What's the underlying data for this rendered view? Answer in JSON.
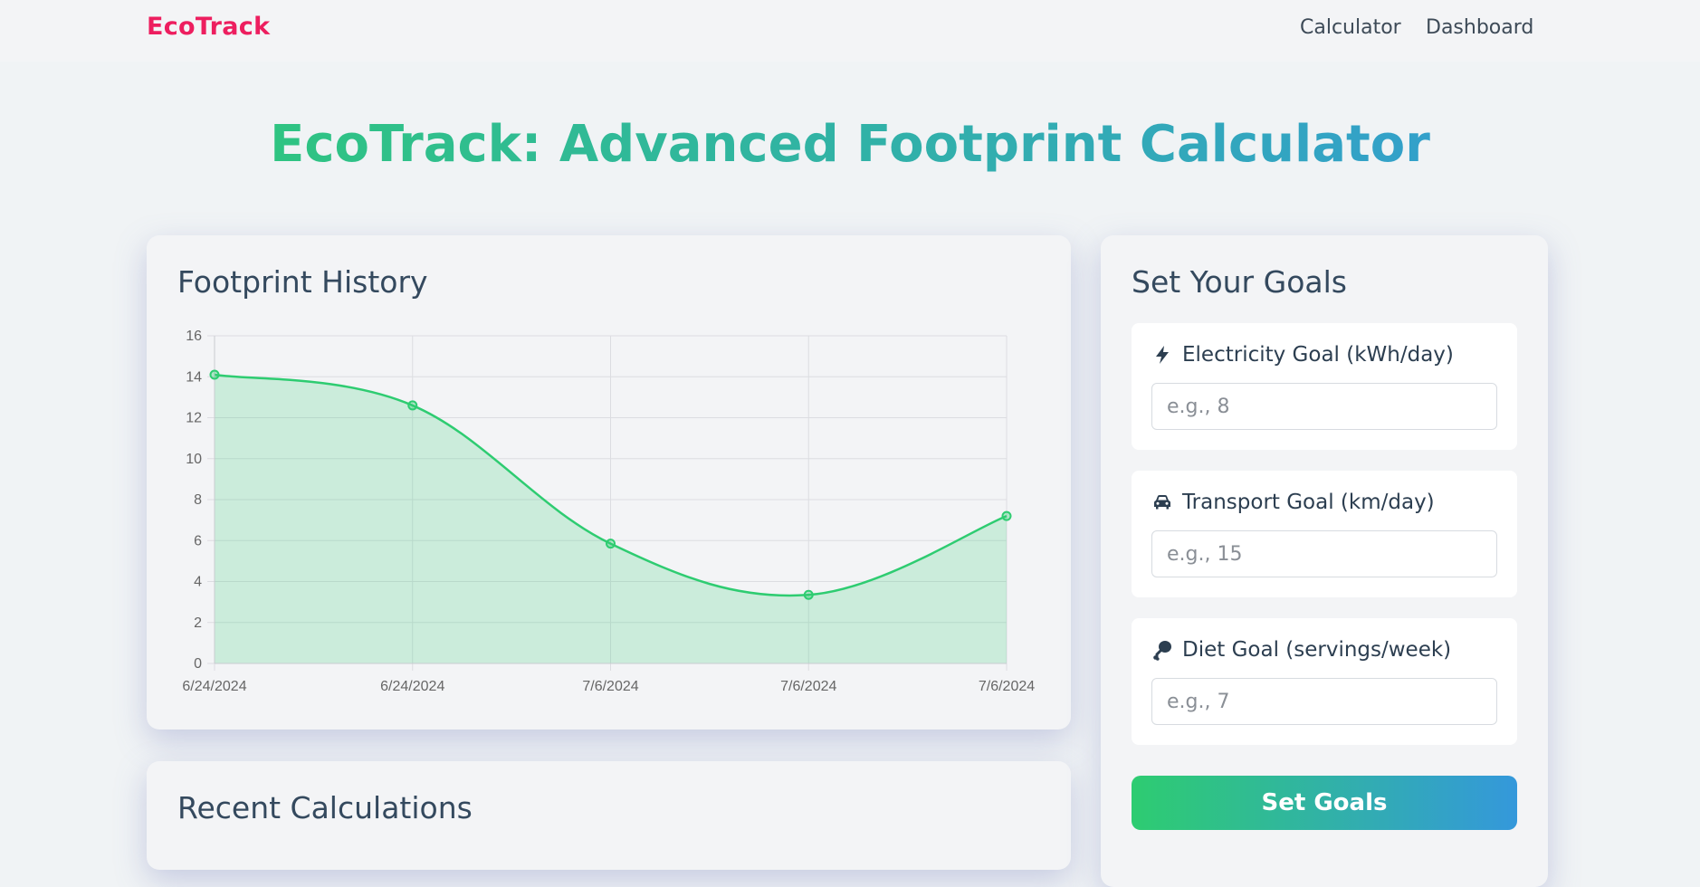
{
  "navbar": {
    "brand": "EcoTrack",
    "links": [
      "Calculator",
      "Dashboard"
    ]
  },
  "hero": {
    "title": "EcoTrack: Advanced Footprint Calculator"
  },
  "history": {
    "title": "Footprint History"
  },
  "recent": {
    "title": "Recent Calculations"
  },
  "goals": {
    "title": "Set Your Goals",
    "fields": [
      {
        "label": "Electricity Goal (kWh/day)",
        "placeholder": "e.g., 8",
        "icon": "bolt-icon"
      },
      {
        "label": "Transport Goal (km/day)",
        "placeholder": "e.g., 15",
        "icon": "car-icon"
      },
      {
        "label": "Diet Goal (servings/week)",
        "placeholder": "e.g., 7",
        "icon": "drumstick-icon"
      }
    ],
    "button_label": "Set Goals"
  },
  "colors": {
    "brand": "#ed1e5f",
    "gradient_start": "#2ecc71",
    "gradient_end": "#3498db",
    "line": "#2ecc71",
    "fill": "rgba(46, 204, 113, 0.2)"
  },
  "chart_data": {
    "type": "area",
    "categories": [
      "6/24/2024",
      "6/24/2024",
      "7/6/2024",
      "7/6/2024",
      "7/6/2024"
    ],
    "values": [
      14.1,
      12.6,
      5.85,
      3.35,
      7.2
    ],
    "ylim": [
      0,
      16
    ],
    "yticks": [
      0,
      2,
      4,
      6,
      8,
      10,
      12,
      14,
      16
    ],
    "grid": true,
    "legend": "none"
  }
}
